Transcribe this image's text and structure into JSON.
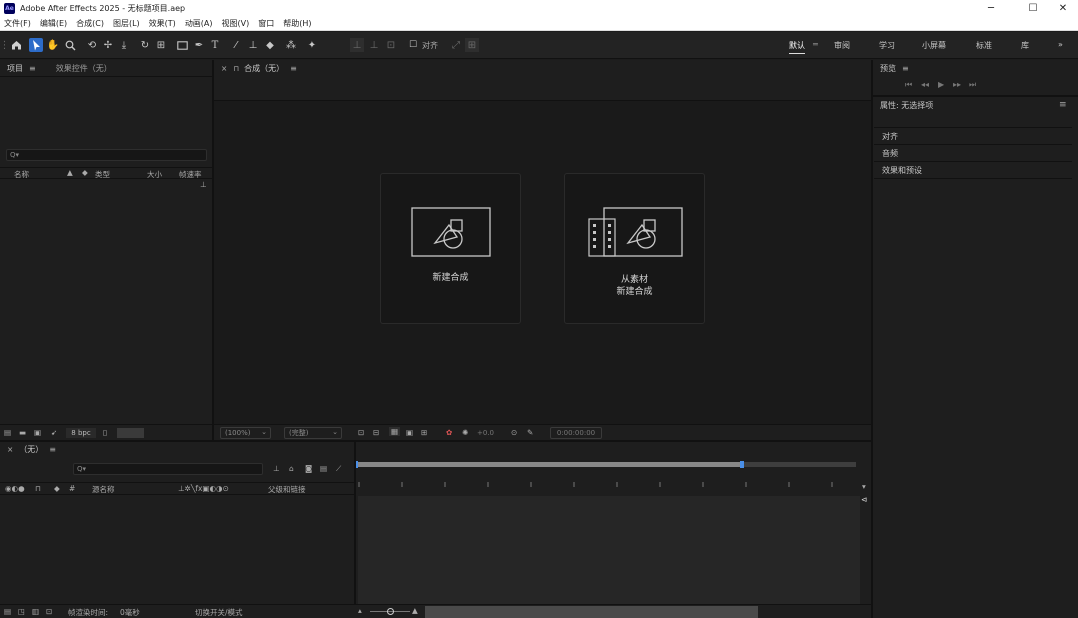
{
  "window": {
    "logo": "Ae",
    "title": "Adobe After Effects 2025 - 无标题项目.aep",
    "minimize": "─",
    "maximize": "☐",
    "close": "✕"
  },
  "menu": [
    "文件(F)",
    "编辑(E)",
    "合成(C)",
    "图层(L)",
    "效果(T)",
    "动画(A)",
    "视图(V)",
    "窗口",
    "帮助(H)"
  ],
  "toolbar": {
    "align_label": "对齐",
    "workspaces": [
      "默认",
      "审阅",
      "学习",
      "小屏幕",
      "标准",
      "库"
    ],
    "more": "»"
  },
  "project_panel": {
    "tabs": [
      "项目",
      "效果控件（无）"
    ],
    "search_placeholder": "Q▾",
    "columns": [
      "名称",
      "类型",
      "大小",
      "帧速率"
    ],
    "bpc": "8 bpc"
  },
  "composition_panel": {
    "tab": "合成（无）",
    "new_comp_label": "新建合成",
    "from_footage_line1": "从素材",
    "from_footage_line2": "新建合成",
    "zoom_value": "(100%)",
    "resolution_value": "(完整)",
    "exposure_value": "+0.0",
    "timecode": "0:00:00:00"
  },
  "preview_panel": {
    "title": "预览"
  },
  "properties_panel": {
    "title": "属性: 无选择项",
    "rows": [
      "对齐",
      "音频",
      "效果和预设"
    ]
  },
  "timeline_panel": {
    "tab": "（无）",
    "search_placeholder": "Q▾",
    "layer_name_header": "源名称",
    "parent_header": "父级和链接",
    "render_time_label": "帧渲染时间:",
    "render_time_value": "0毫秒",
    "toggle_label": "切换开关/模式"
  },
  "colors": {
    "accent": "#2d6cc9",
    "panel_bg": "#1e1e1e",
    "app_bg": "#1c1c1c"
  }
}
